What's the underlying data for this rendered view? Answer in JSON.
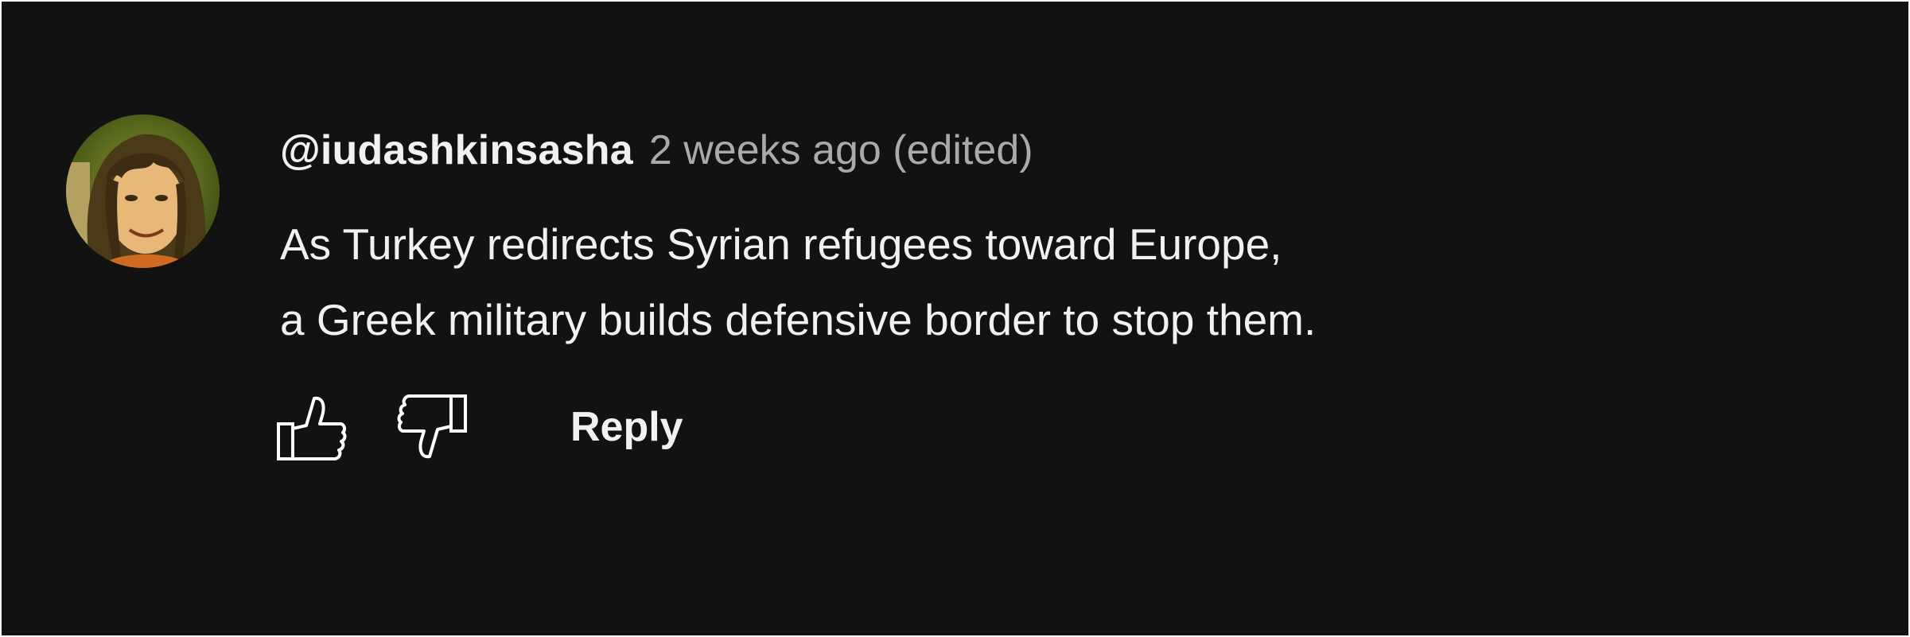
{
  "comment": {
    "author": "@iudashkinsasha",
    "timestamp": "2 weeks ago (edited)",
    "body_lines": [
      "As Turkey redirects Syrian refugees toward Europe,",
      "a Greek military builds defensive border to stop them."
    ]
  },
  "actions": {
    "like_icon": "thumbs-up-outline-icon",
    "dislike_icon": "thumbs-down-outline-icon",
    "reply_label": "Reply"
  },
  "colors": {
    "background": "#121212",
    "frame": "#ffffff",
    "primary_text": "#f1f1f1",
    "secondary_text": "#aaaaaa"
  }
}
